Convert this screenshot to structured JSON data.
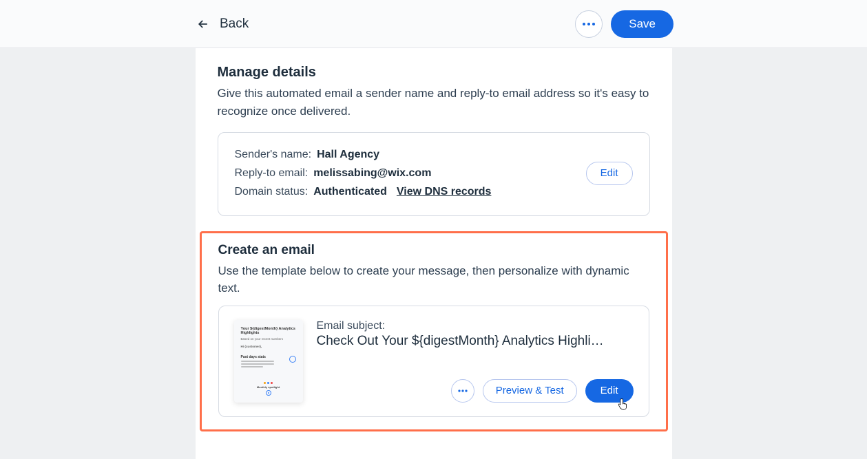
{
  "topbar": {
    "back_label": "Back",
    "save_label": "Save"
  },
  "manage": {
    "title": "Manage details",
    "desc": "Give this automated email a sender name and reply-to email address so it's easy to recognize once delivered.",
    "sender_label": "Sender's name:",
    "sender_value": "Hall Agency",
    "reply_label": "Reply-to email:",
    "reply_value": "melissabing@wix.com",
    "domain_label": "Domain status:",
    "domain_value": "Authenticated",
    "dns_link": "View DNS records",
    "edit_label": "Edit"
  },
  "create": {
    "title": "Create an email",
    "desc": "Use the template below to create your message, then personalize with dynamic text.",
    "subject_label": "Email subject:",
    "subject_value": "Check Out Your ${digestMonth} Analytics Highli…",
    "preview_label": "Preview & Test",
    "edit_label": "Edit",
    "thumb": {
      "title": "Your ${digestMonth} Analytics Highlights",
      "section": "Past days stats"
    }
  }
}
